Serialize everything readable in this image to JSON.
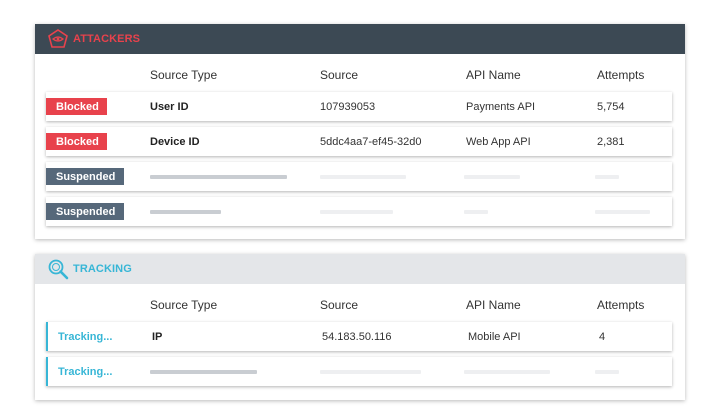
{
  "attackers": {
    "title": "ATTACKERS",
    "icon": "shield-icon",
    "accent": "#e8424c",
    "columns": [
      "Source Type",
      "Source",
      "API Name",
      "Attempts"
    ],
    "rows": [
      {
        "status": "Blocked",
        "source_type": "User ID",
        "source": "107939053",
        "api_name": "Payments API",
        "attempts": "5,754"
      },
      {
        "status": "Blocked",
        "source_type": "Device ID",
        "source": "5ddc4aa7-ef45-32d0",
        "api_name": "Web App API",
        "attempts": "2,381"
      },
      {
        "status": "Suspended"
      },
      {
        "status": "Suspended"
      }
    ]
  },
  "tracking": {
    "title": "TRACKING",
    "icon": "magnifier-icon",
    "accent": "#37b6d6",
    "columns": [
      "Source Type",
      "Source",
      "API Name",
      "Attempts"
    ],
    "rows": [
      {
        "status": "Tracking...",
        "source_type": "IP",
        "source": "54.183.50.116",
        "api_name": "Mobile API",
        "attempts": "4"
      },
      {
        "status": "Tracking..."
      }
    ]
  },
  "colors": {
    "blocked": "#e8424c",
    "suspended": "#56687a",
    "header_dark": "#3c4954",
    "header_light": "#e4e6e9"
  }
}
